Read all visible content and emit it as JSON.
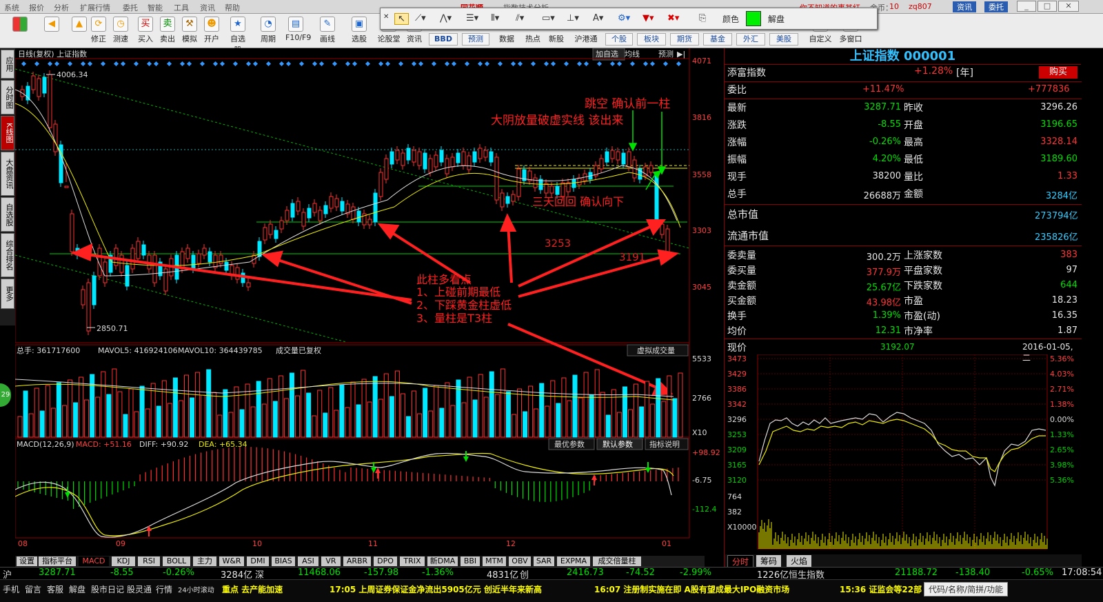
{
  "menu": {
    "items": [
      "系统",
      "报价",
      "分析",
      "扩展行情",
      "委托",
      "智能",
      "工具",
      "资讯",
      "帮助"
    ],
    "brand": "同花顺",
    "title": "指数技术分析",
    "user": "zq807",
    "right_info": "你不知道的事其红",
    "cfg": "金币：",
    "cfg_val": "10",
    "btn_news": "资讯",
    "btn_trade": "委托"
  },
  "toolbar": {
    "buttons": [
      "修正",
      "测速",
      "买入",
      "卖出",
      "模拟",
      "开户",
      "自选股",
      "周期",
      "F10/F9",
      "画线",
      "选股",
      "论股堂",
      "资讯",
      "预测",
      "数据",
      "热点",
      "新股",
      "沪港通",
      "个股",
      "板块",
      "期货",
      "基金",
      "外汇",
      "美股",
      "自定义",
      "多窗口"
    ],
    "bbd": "BBD",
    "color_label": "颜色",
    "unlock": "解盘"
  },
  "left_tabs": [
    "应用",
    "分时图",
    "K线图",
    "大盘资讯",
    "自选股",
    "综合排名",
    "更多"
  ],
  "chart_header": {
    "left": "日线(复权)  上证指数",
    "btns": [
      "加自选",
      "均线",
      "预测"
    ]
  },
  "price_axis": [
    "4071",
    "3816",
    "3558",
    "3303",
    "3045"
  ],
  "labels": {
    "high": "4006.34",
    "low": "2850.71",
    "lv1": "3253",
    "lv2": "3191"
  },
  "annotations": {
    "a1": "跳空  确认前一柱",
    "a2": "大阴放量破虚实线  该出来",
    "a3": "三天回回  确认向下",
    "a4": "此柱多看点",
    "a5": "1、上碰前期最低",
    "a6": "2、下踩黄金柱虚低",
    "a7": "3、量柱是T3柱"
  },
  "volume": {
    "header": "总手: 361717600",
    "mavol5": "MAVOL5: 416924106",
    "mavol10": "MAVOL10: 364439785",
    "note": "成交量已复权",
    "btn": "虚拟成交量",
    "axis": [
      "5533",
      "2766",
      "X10"
    ]
  },
  "macd": {
    "header": "MACD(12,26,9)",
    "macd": "MACD: +51.16",
    "diff": "DIFF: +90.92",
    "dea": "DEA: +65.34",
    "btns": [
      "最优参数",
      "默认参数",
      "指标说明"
    ],
    "axis": [
      "+98.92",
      "-6.75",
      "-112.4"
    ]
  },
  "x_axis": [
    "08",
    "09",
    "10",
    "11",
    "12",
    "01"
  ],
  "indicator_tabs": [
    "设置",
    "指标平台",
    "MACD",
    "KDJ",
    "RSI",
    "BOLL",
    "主力",
    "W&R",
    "DMI",
    "BIAS",
    "ASI",
    "VR",
    "ARBR",
    "DPO",
    "TRIX",
    "新DMA",
    "BBI",
    "MTM",
    "OBV",
    "SAR",
    "EXPMA",
    "成交倍量柱"
  ],
  "quote": {
    "title": "上证指数 000001",
    "buy": "购买",
    "r1": [
      "添富指数",
      "+1.28%",
      "[年]"
    ],
    "r2": [
      "委比",
      "+11.47%",
      "+777836"
    ],
    "rows": [
      [
        "最新",
        "3287.71",
        "昨收",
        "3296.26"
      ],
      [
        "涨跌",
        "-8.55",
        "开盘",
        "3196.65"
      ],
      [
        "涨幅",
        "-0.26%",
        "最高",
        "3328.14"
      ],
      [
        "振幅",
        "4.20%",
        "最低",
        "3189.60"
      ],
      [
        "现手",
        "38200",
        "量比",
        "1.33"
      ],
      [
        "总手",
        "26688万",
        "金额",
        "3284亿"
      ]
    ],
    "mcap": [
      "总市值",
      "273794亿"
    ],
    "fmcap": [
      "流通市值",
      "235826亿"
    ],
    "rows2": [
      [
        "委卖量",
        "300.2万",
        "上涨家数",
        "383"
      ],
      [
        "委买量",
        "377.9万",
        "平盘家数",
        "97"
      ],
      [
        "卖金额",
        "25.67亿",
        "下跌家数",
        "644"
      ],
      [
        "买金额",
        "43.98亿",
        "市盈",
        "18.23"
      ],
      [
        "换手",
        "1.39%",
        "市盈(动)",
        "16.35"
      ],
      [
        "均价",
        "12.31",
        "市净率",
        "1.87"
      ]
    ],
    "now": [
      "现价",
      "3192.07",
      "2016-01-05,二"
    ]
  },
  "intraday": {
    "price_axis": [
      "3473",
      "3429",
      "3386",
      "3342",
      "3296",
      "3253",
      "3209",
      "3165",
      "3120",
      "764",
      "382",
      "X10000"
    ],
    "pct_axis": [
      "5.36%",
      "4.03%",
      "2.71%",
      "1.38%",
      "0.00%",
      "1.33%",
      "2.65%",
      "3.98%",
      "5.36%"
    ],
    "tabs": [
      "分时",
      "筹码",
      "火焰"
    ]
  },
  "bottom": {
    "sh": "沪",
    "sh_v": "3287.71",
    "sh_c": "-8.55",
    "sh_p": "-0.26%",
    "sh_a": "3284亿",
    "sz": "深",
    "sz_v": "11468.06",
    "sz_c": "-157.98",
    "sz_p": "-1.36%",
    "sz_a": "4831亿",
    "cy": "创",
    "cy_v": "2416.73",
    "cy_c": "-74.52",
    "cy_p": "-2.99%",
    "cy_a": "1226亿",
    "hs": "恒生指数",
    "hs_v": "21188.72",
    "hs_c": "-138.40",
    "hs_p": "-0.65%",
    "time": "17:08:54"
  },
  "status": {
    "items": [
      "手机",
      "留言",
      "客服",
      "解盘",
      "股市日记",
      "股灵通",
      "行情",
      "24小时滚动"
    ],
    "news1": "重点  去产能加速",
    "news2": "17:05 上周证券保证金净流出5905亿元 创近半年来新高",
    "news3": "16:07 注册制实施在即  A股有望成最大IPO融资市场",
    "news4": "15:36 证监会等22部",
    "quick": "代码/名称/简拼/功能",
    "badge": "29"
  }
}
